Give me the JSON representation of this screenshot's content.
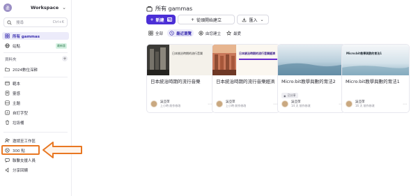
{
  "sidebar": {
    "workspace": {
      "initial": "柔",
      "name": "Workspace"
    },
    "search": {
      "placeholder": "搜尋",
      "shortcut": "Ctrl+K"
    },
    "nav_top": [
      {
        "label": "所有 gammas",
        "icon": "grid-icon",
        "active": true
      },
      {
        "label": "站點",
        "icon": "globe-icon",
        "badge": "最新版"
      }
    ],
    "folders_title": "資料夾",
    "folders": [
      {
        "label": "2024數位深耕",
        "icon": "folder-icon"
      }
    ],
    "nav_mid": [
      {
        "label": "範本",
        "icon": "template-icon"
      },
      {
        "label": "靈感",
        "icon": "inspiration-icon"
      },
      {
        "label": "主題",
        "icon": "palette-icon"
      },
      {
        "label": "自訂字型",
        "icon": "font-icon"
      },
      {
        "label": "垃圾桶",
        "icon": "trash-icon"
      }
    ],
    "nav_bottom": [
      {
        "label": "邀請至工作區",
        "icon": "invite-icon"
      },
      {
        "label": "300 點",
        "icon": "credits-icon"
      },
      {
        "label": "聯繫支援人員",
        "icon": "support-icon"
      },
      {
        "label": "分享回饋",
        "icon": "feedback-icon"
      }
    ]
  },
  "main": {
    "title": "所有 gammas",
    "toolbar": {
      "new_label": "新建",
      "new_ai_label": "AI",
      "blank_label": "從頭開始建立",
      "import_label": "匯入"
    },
    "filters": [
      {
        "label": "全部",
        "icon": "grid-icon",
        "active": false
      },
      {
        "label": "最近瀏覽",
        "icon": "clock-icon",
        "active": true
      },
      {
        "label": "由您建立",
        "icon": "person-icon",
        "active": false
      },
      {
        "label": "最愛",
        "icon": "star-icon",
        "active": false
      }
    ],
    "cards": [
      {
        "thumb_text": "日本統治時期的流行音樂",
        "title": "日本統治時期的流行音樂",
        "author": "吳亞萍",
        "time": "上小時 前作修改",
        "tag": ""
      },
      {
        "thumb_text": "日本統治時期的流行音樂經濟",
        "title": "日本統治時期的流行音樂經濟",
        "author": "吳亞萍",
        "time": "上小時 前作修改",
        "tag": ""
      },
      {
        "thumb_text": "",
        "title": "Micro:bit教學與數的育法2",
        "author": "吳亞萍",
        "time": "14 天 前作修改",
        "tag": "已分享"
      },
      {
        "thumb_text": "Micro:bit教學與數的育法1",
        "title": "Micro:bit教學與數的育法1",
        "author": "吳亞萍",
        "time": "16 天 前作修改",
        "tag": ""
      }
    ]
  },
  "colors": {
    "accent": "#4b2fd6",
    "active_bg": "#ecebfa",
    "annotation": "#e87722"
  }
}
